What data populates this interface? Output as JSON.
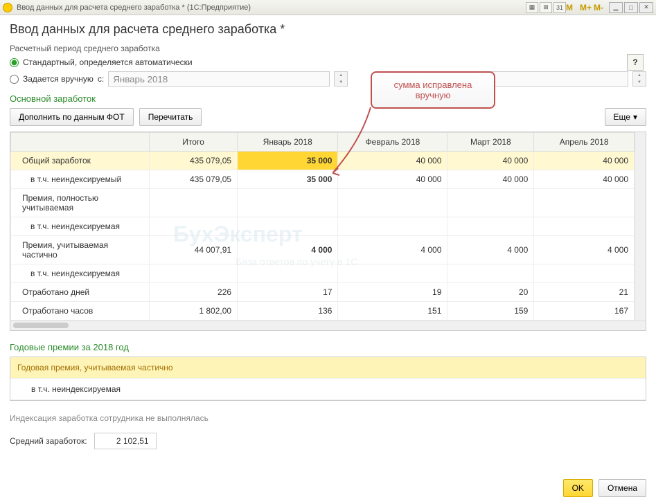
{
  "titlebar": {
    "title": "Ввод данных для расчета среднего заработка * (1С:Предприятие)",
    "m_buttons": [
      "M",
      "M+",
      "M-"
    ]
  },
  "header": {
    "page_title": "Ввод данных для расчета среднего заработка *",
    "period_label": "Расчетный период среднего заработка",
    "radio_auto": "Стандартный, определяется автоматически",
    "radio_manual": "Задается вручную",
    "from_label": "с:",
    "period_value": "Январь 2018",
    "help": "?"
  },
  "callout": {
    "line1": "сумма исправлена",
    "line2": "вручную"
  },
  "section1": {
    "title": "Основной заработок",
    "btn_add": "Дополнить по данным ФОТ",
    "btn_recalc": "Перечитать",
    "btn_more": "Еще",
    "columns": [
      "",
      "Итого",
      "Январь 2018",
      "Февраль 2018",
      "Март 2018",
      "Апрель 2018"
    ],
    "rows": [
      {
        "label": "Общий заработок",
        "vals": [
          "435 079,05",
          "35 000",
          "40 000",
          "40 000",
          "40 000"
        ],
        "yellow": true,
        "hl_col": 1
      },
      {
        "label": "в т.ч. неиндексируемый",
        "vals": [
          "435 079,05",
          "35 000",
          "40 000",
          "40 000",
          "40 000"
        ],
        "indent": true,
        "bold_col": 1
      },
      {
        "label": "Премия, полностью учитываемая",
        "vals": [
          "",
          "",
          "",
          "",
          ""
        ]
      },
      {
        "label": "в т.ч. неиндексируемая",
        "vals": [
          "",
          "",
          "",
          "",
          ""
        ],
        "indent": true
      },
      {
        "label": "Премия, учитываемая частично",
        "vals": [
          "44 007,91",
          "4 000",
          "4 000",
          "4 000",
          "4 000"
        ],
        "bold_col": 1
      },
      {
        "label": "в т.ч. неиндексируемая",
        "vals": [
          "",
          "",
          "",
          "",
          ""
        ],
        "indent": true
      },
      {
        "label": "Отработано дней",
        "vals": [
          "226",
          "17",
          "19",
          "20",
          "21"
        ]
      },
      {
        "label": "Отработано часов",
        "vals": [
          "1 802,00",
          "136",
          "151",
          "159",
          "167"
        ]
      }
    ]
  },
  "section2": {
    "title": "Годовые премии за 2018 год",
    "row_header": "Годовая премия, учитываемая частично",
    "row_sub": "в т.ч. неиндексируемая"
  },
  "index_note": "Индексация заработка сотрудника не выполнялась",
  "avg": {
    "label": "Средний заработок:",
    "value": "2 102,51"
  },
  "footer": {
    "ok": "OK",
    "cancel": "Отмена"
  },
  "watermark": {
    "brand": "БухЭксперт",
    "sub": "База ответов по учету в 1С"
  }
}
